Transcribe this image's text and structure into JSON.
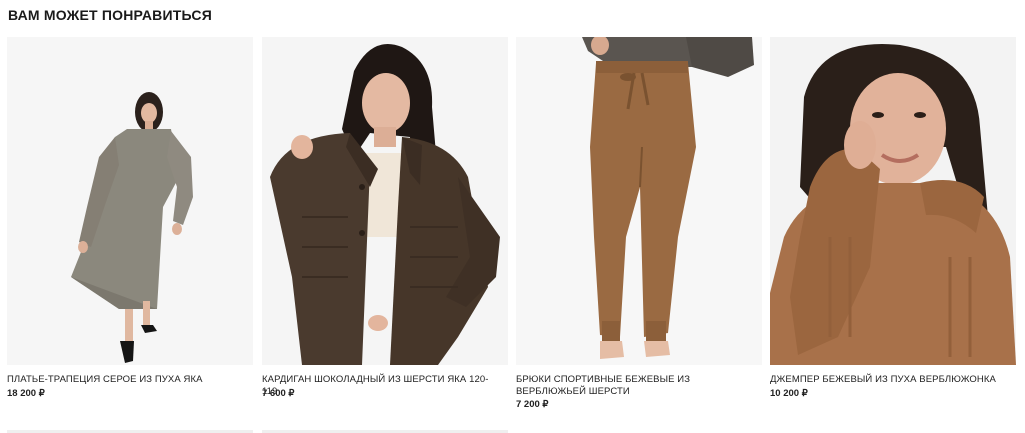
{
  "section": {
    "title": "ВАМ МОЖЕТ ПОНРАВИТЬСЯ"
  },
  "products": [
    {
      "name": "ПЛАТЬЕ-ТРАПЕЦИЯ СЕРОЕ ИЗ ПУХА ЯКА",
      "price": "18 200 ₽",
      "color": "#8b887d"
    },
    {
      "name": "КАРДИГАН ШОКОЛАДНЫЙ ИЗ ШЕРСТИ ЯКА 120-119",
      "price": "7 600 ₽",
      "color": "#4a3a2e"
    },
    {
      "name": "БРЮКИ СПОРТИВНЫЕ БЕЖЕВЫЕ ИЗ ВЕРБЛЮЖЬЕЙ ШЕРСТИ",
      "price": "7 200 ₽",
      "color": "#9a6a42"
    },
    {
      "name": "ДЖЕМПЕР БЕЖЕВЫЙ ИЗ ПУХА ВЕРБЛЮЖОНКА",
      "price": "10 200 ₽",
      "color": "#a8714a"
    }
  ]
}
